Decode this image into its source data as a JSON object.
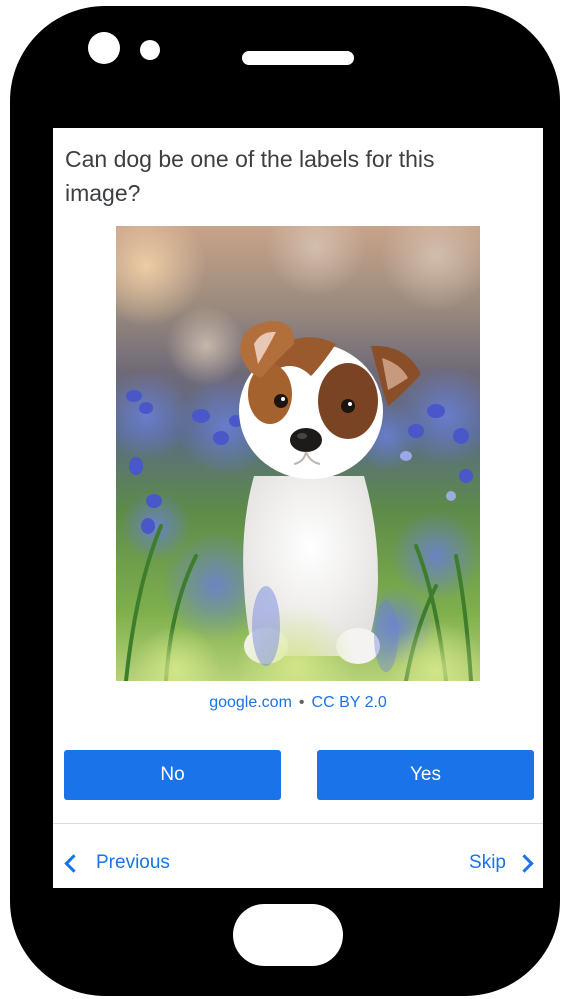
{
  "question": {
    "text": "Can dog be one of the labels for this image?"
  },
  "image": {
    "subject": "puppy-in-flowers",
    "attribution_source": "google.com",
    "attribution_separator": "•",
    "attribution_license": "CC BY 2.0"
  },
  "buttons": {
    "no_label": "No",
    "yes_label": "Yes"
  },
  "navigation": {
    "previous_label": "Previous",
    "skip_label": "Skip"
  },
  "colors": {
    "accent": "#1a73e8",
    "phone_body": "#000000",
    "question_text": "#3c4043"
  },
  "icons": {
    "previous": "chevron-left-icon",
    "skip": "chevron-right-icon"
  }
}
